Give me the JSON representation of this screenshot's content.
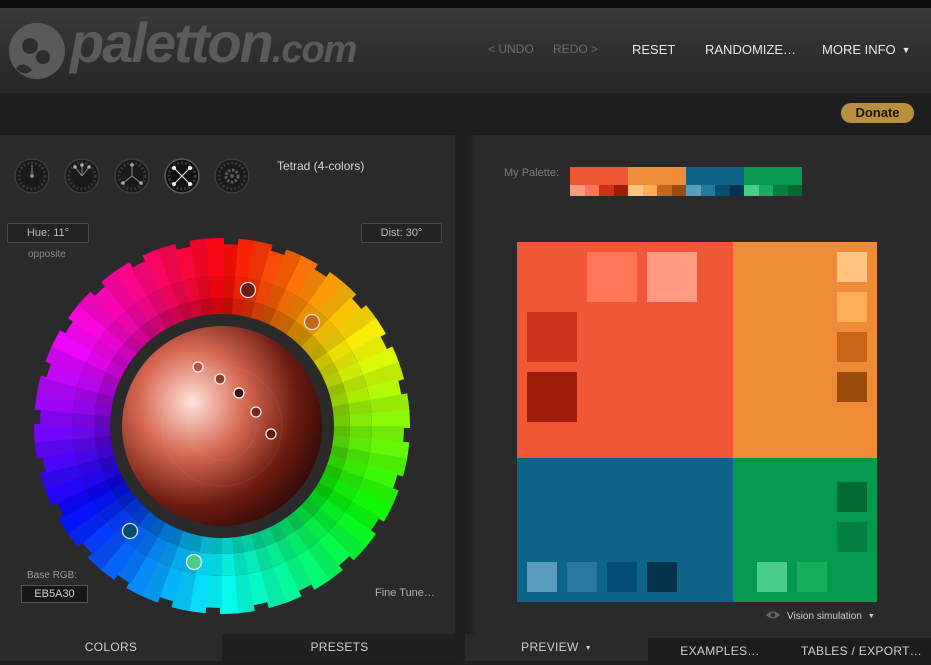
{
  "header": {
    "logo_text_main": "paletton",
    "logo_text_domain": ".com",
    "nav": {
      "undo": "< UNDO",
      "redo": "REDO >",
      "reset": "RESET",
      "randomize": "RANDOMIZE…",
      "more_info": "MORE INFO"
    }
  },
  "donate_label": "Donate",
  "left_panel": {
    "scheme_label": "Tetrad (4-colors)",
    "scheme_icons": [
      "mono-icon",
      "adjacent-icon",
      "triad-icon",
      "tetrad-icon",
      "free-style-icon"
    ],
    "hue_label": "Hue: 11°",
    "dist_label": "Dist: 30°",
    "opposite_label": "opposite",
    "base_rgb_label": "Base RGB:",
    "base_rgb_value": "EB5A30",
    "fine_tune_label": "Fine Tune…",
    "tabs": {
      "colors": "COLORS",
      "presets": "PRESETS"
    }
  },
  "right_panel": {
    "my_palette_label": "My Palette:",
    "vision_label": "Vision simulation",
    "tabs": {
      "preview": "PREVIEW",
      "examples": "EXAMPLES…",
      "tables": "TABLES / EXPORT…"
    }
  },
  "palette": {
    "primary": {
      "main": "#EF5737",
      "shades": [
        "#FF9A82",
        "#FF7657",
        "#CD3318",
        "#A01D0A"
      ]
    },
    "secondary1": {
      "main": "#EF8A36",
      "shades": [
        "#FFC583",
        "#FFAE55",
        "#C7651B",
        "#9B4C0D"
      ]
    },
    "secondary2": {
      "main": "#0E6389",
      "shades": [
        "#5A9CBE",
        "#27779F",
        "#044D72",
        "#03324C"
      ]
    },
    "complement": {
      "main": "#05994F",
      "shades": [
        "#48CC87",
        "#16AE5E",
        "#028040",
        "#006930"
      ]
    }
  }
}
